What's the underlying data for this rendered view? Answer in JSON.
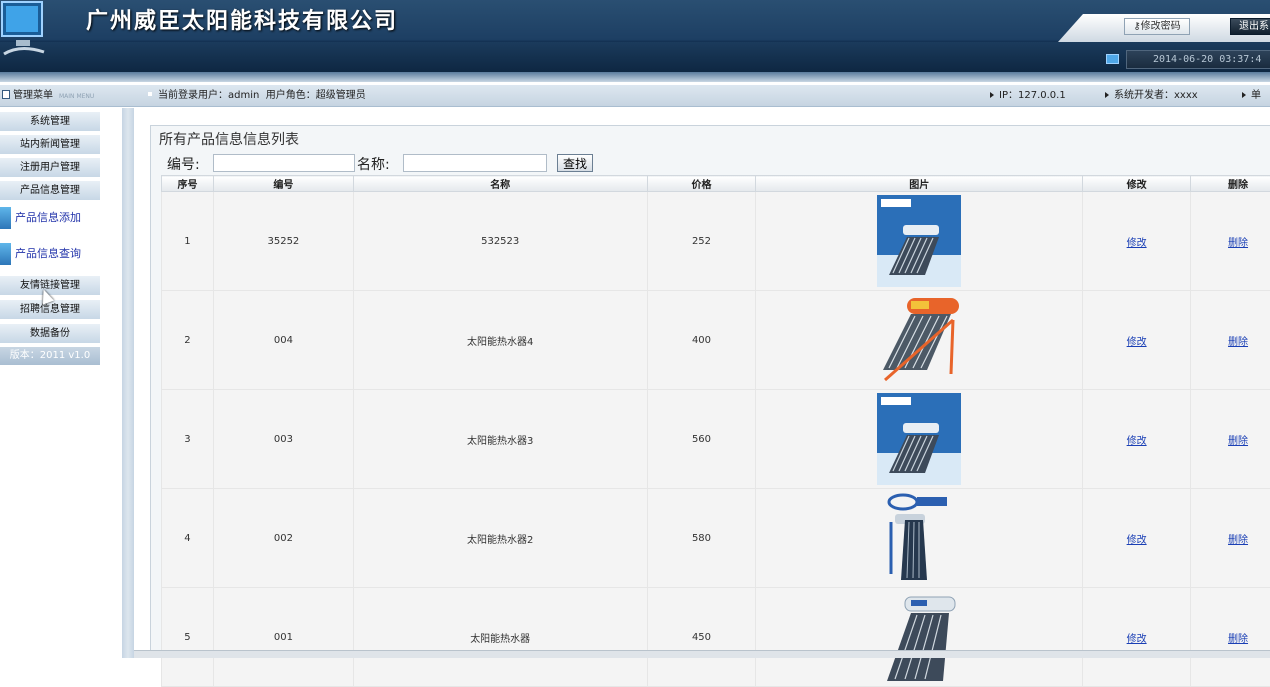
{
  "header": {
    "company_name": "广州威臣太阳能科技有限公司",
    "change_password_label": "修改密码",
    "logout_label": "退出系",
    "datetime": "2014-06-20 03:37:4"
  },
  "infobar": {
    "menu_title": "管理菜单",
    "menu_subtitle": "MAIN MENU",
    "current_user_label": "当前登录用户：",
    "current_user": "admin",
    "role_label": "用户角色：",
    "role": "超级管理员",
    "ip_label": "IP：",
    "ip": "127.0.0.1",
    "developer_label": "系统开发者：",
    "developer": "xxxx",
    "more_label": "单"
  },
  "sidebar": {
    "items": [
      {
        "label": "系统管理"
      },
      {
        "label": "站内新闻管理"
      },
      {
        "label": "注册用户管理"
      },
      {
        "label": "产品信息管理"
      }
    ],
    "links": [
      {
        "label": "产品信息添加"
      },
      {
        "label": "产品信息查询"
      }
    ],
    "items2": [
      {
        "label": "友情链接管理"
      },
      {
        "label": "招聘信息管理"
      },
      {
        "label": "数据备份"
      }
    ],
    "version": "版本：2011 v1.0"
  },
  "main": {
    "panel_title": "所有产品信息信息列表",
    "search": {
      "code_label": "编号:",
      "name_label": "名称:",
      "code_value": "",
      "name_value": "",
      "search_button": "查找"
    },
    "table": {
      "headers": [
        "序号",
        "编号",
        "名称",
        "价格",
        "图片",
        "修改",
        "删除"
      ],
      "edit_label": "修改",
      "delete_label": "删除",
      "rows": [
        {
          "seq": "1",
          "code": "35252",
          "name": "532523",
          "price": "252",
          "image": "blue-box-heater"
        },
        {
          "seq": "2",
          "code": "004",
          "name": "太阳能热水器4",
          "price": "400",
          "image": "orange-frame-heater"
        },
        {
          "seq": "3",
          "code": "003",
          "name": "太阳能热水器3",
          "price": "560",
          "image": "blue-box-heater"
        },
        {
          "seq": "4",
          "code": "002",
          "name": "太阳能热水器2",
          "price": "580",
          "image": "logo-heater"
        },
        {
          "seq": "5",
          "code": "001",
          "name": "太阳能热水器",
          "price": "450",
          "image": "tube-heater"
        }
      ]
    }
  },
  "colors": {
    "header_dark": "#17385a",
    "link_blue": "#1a3fb5",
    "sidebar_item": "#c7d7e6"
  }
}
